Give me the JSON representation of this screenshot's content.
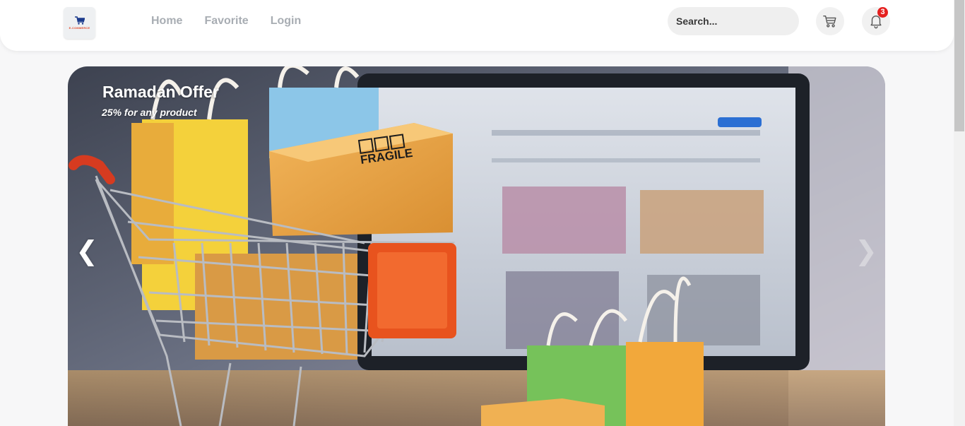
{
  "brand": {
    "logo_text": "E-COMMERCE"
  },
  "nav": {
    "items": [
      {
        "label": "Home"
      },
      {
        "label": "Favorite"
      },
      {
        "label": "Login"
      }
    ]
  },
  "search": {
    "placeholder": "Search..."
  },
  "header_icons": {
    "cart": "cart-icon",
    "bell": "bell-icon",
    "notification_count": "3"
  },
  "slider": {
    "title": "Ramadan Offer",
    "subtitle": "25% for any product",
    "prev_label": "❮",
    "next_label": "❯",
    "box_label": "FRAGILE"
  },
  "colors": {
    "badge": "#e5201f",
    "nav_text": "#a8adb3",
    "logo_accent": "#e34b2c"
  }
}
